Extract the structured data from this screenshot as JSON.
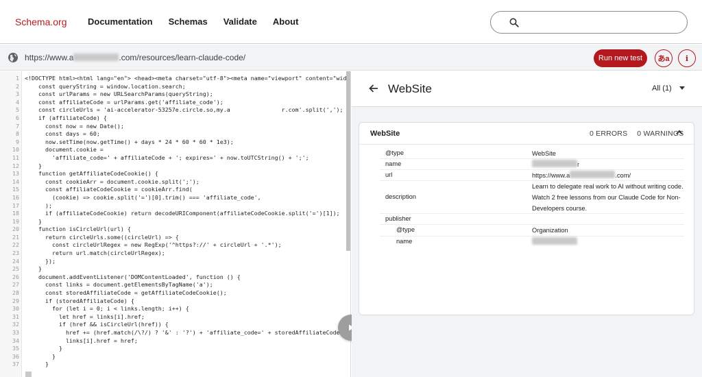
{
  "header": {
    "logo": "Schema.org",
    "nav": [
      "Documentation",
      "Schemas",
      "Validate",
      "About"
    ]
  },
  "urlbar": {
    "url_prefix": "https://www.a",
    "url_suffix": ".com/resources/learn-claude-code/",
    "run_label": "Run new test",
    "lang_glyph": "あa",
    "info_glyph": "i"
  },
  "code": {
    "lines": [
      {
        "n": "1",
        "t": "<!DOCTYPE html><html lang=\"en\"> <head><meta charset=\"utf-8\"><meta name=\"viewport\" content=\"width=dev"
      },
      {
        "n": "2",
        "t": "    const queryString = window.location.search;"
      },
      {
        "n": "3",
        "t": "    const urlParams = new URLSearchParams(queryString);"
      },
      {
        "n": "4",
        "t": "    const affiliateCode = urlParams.get('affiliate_code');"
      },
      {
        "n": "5",
        "t": "    const circleUrls = 'ai-accelerator-53257e.circle.so,my.a               r.com'.split(',');"
      },
      {
        "n": "6",
        "t": "    if (affiliateCode) {"
      },
      {
        "n": "7",
        "t": "      const now = new Date();"
      },
      {
        "n": "8",
        "t": "      const days = 60;"
      },
      {
        "n": "9",
        "t": "      now.setTime(now.getTime() + days * 24 * 60 * 60 * 1e3);"
      },
      {
        "n": "10",
        "t": "      document.cookie ="
      },
      {
        "n": "11",
        "t": "        'affiliate_code=' + affiliateCode + '; expires=' + now.toUTCString() + ';';"
      },
      {
        "n": "12",
        "t": "    }"
      },
      {
        "n": "13",
        "t": "    function getAffiliateCodeCookie() {"
      },
      {
        "n": "14",
        "t": "      const cookieArr = document.cookie.split(';');"
      },
      {
        "n": "15",
        "t": "      const affiliateCodeCookie = cookieArr.find("
      },
      {
        "n": "16",
        "t": "        (cookie) => cookie.split('=')[0].trim() === 'affiliate_code',"
      },
      {
        "n": "17",
        "t": "      );"
      },
      {
        "n": "18",
        "t": "      if (affiliateCodeCookie) return decodeURIComponent(affiliateCodeCookie.split('=')[1]);"
      },
      {
        "n": "19",
        "t": "    }"
      },
      {
        "n": "20",
        "t": "    function isCircleUrl(url) {"
      },
      {
        "n": "21",
        "t": "      return circleUrls.some((circleUrl) => {"
      },
      {
        "n": "22",
        "t": "        const circleUrlRegex = new RegExp('^https?://' + circleUrl + '.*');"
      },
      {
        "n": "23",
        "t": "        return url.match(circleUrlRegex);"
      },
      {
        "n": "24",
        "t": "      });"
      },
      {
        "n": "25",
        "t": "    }"
      },
      {
        "n": "26",
        "t": "    document.addEventListener('DOMContentLoaded', function () {"
      },
      {
        "n": "27",
        "t": "      const links = document.getElementsByTagName('a');"
      },
      {
        "n": "28",
        "t": "      const storedAffiliateCode = getAffiliateCodeCookie();"
      },
      {
        "n": "29",
        "t": "      if (storedAffiliateCode) {"
      },
      {
        "n": "30",
        "t": "        for (let i = 0; i < links.length; i++) {"
      },
      {
        "n": "31",
        "t": "          let href = links[i].href;"
      },
      {
        "n": "32",
        "t": "          if (href && isCircleUrl(href)) {"
      },
      {
        "n": "33",
        "t": "            href += (href.match(/\\?/) ? '&' : '?') + 'affiliate_code=' + storedAffiliateCode;"
      },
      {
        "n": "34",
        "t": "            links[i].href = href;"
      },
      {
        "n": "35",
        "t": "          }"
      },
      {
        "n": "36",
        "t": "        }"
      },
      {
        "n": "37",
        "t": "      }"
      }
    ]
  },
  "result": {
    "title": "WebSite",
    "filter": "All (1)",
    "card": {
      "title": "WebSite",
      "errors": "0 ERRORS",
      "warnings": "0 WARNINGS",
      "props": [
        {
          "key": "@type",
          "value": "WebSite",
          "nested": false
        },
        {
          "key": "name",
          "value": "r",
          "nested": false
        },
        {
          "key": "url",
          "value_prefix": "https://www.a",
          "value_suffix": ".com/",
          "nested": false
        },
        {
          "key": "description",
          "value": "Learn to delegate real work to AI without writing code. Watch 2 free lessons from our Claude Code for Non-Developers course.",
          "nested": false
        },
        {
          "key": "publisher",
          "value": "",
          "nested": false
        },
        {
          "key": "@type",
          "value": "Organization",
          "nested": true
        },
        {
          "key": "name",
          "value": "",
          "nested": true
        }
      ]
    }
  },
  "colors": {
    "brand": "#b51c24",
    "button": "#b3181f"
  },
  "icons": {
    "search": "search-icon",
    "globe": "globe-icon",
    "back": "arrow-left-icon",
    "caret": "caret-down-icon",
    "collapse": "chevron-up-icon",
    "play": "play-icon"
  }
}
